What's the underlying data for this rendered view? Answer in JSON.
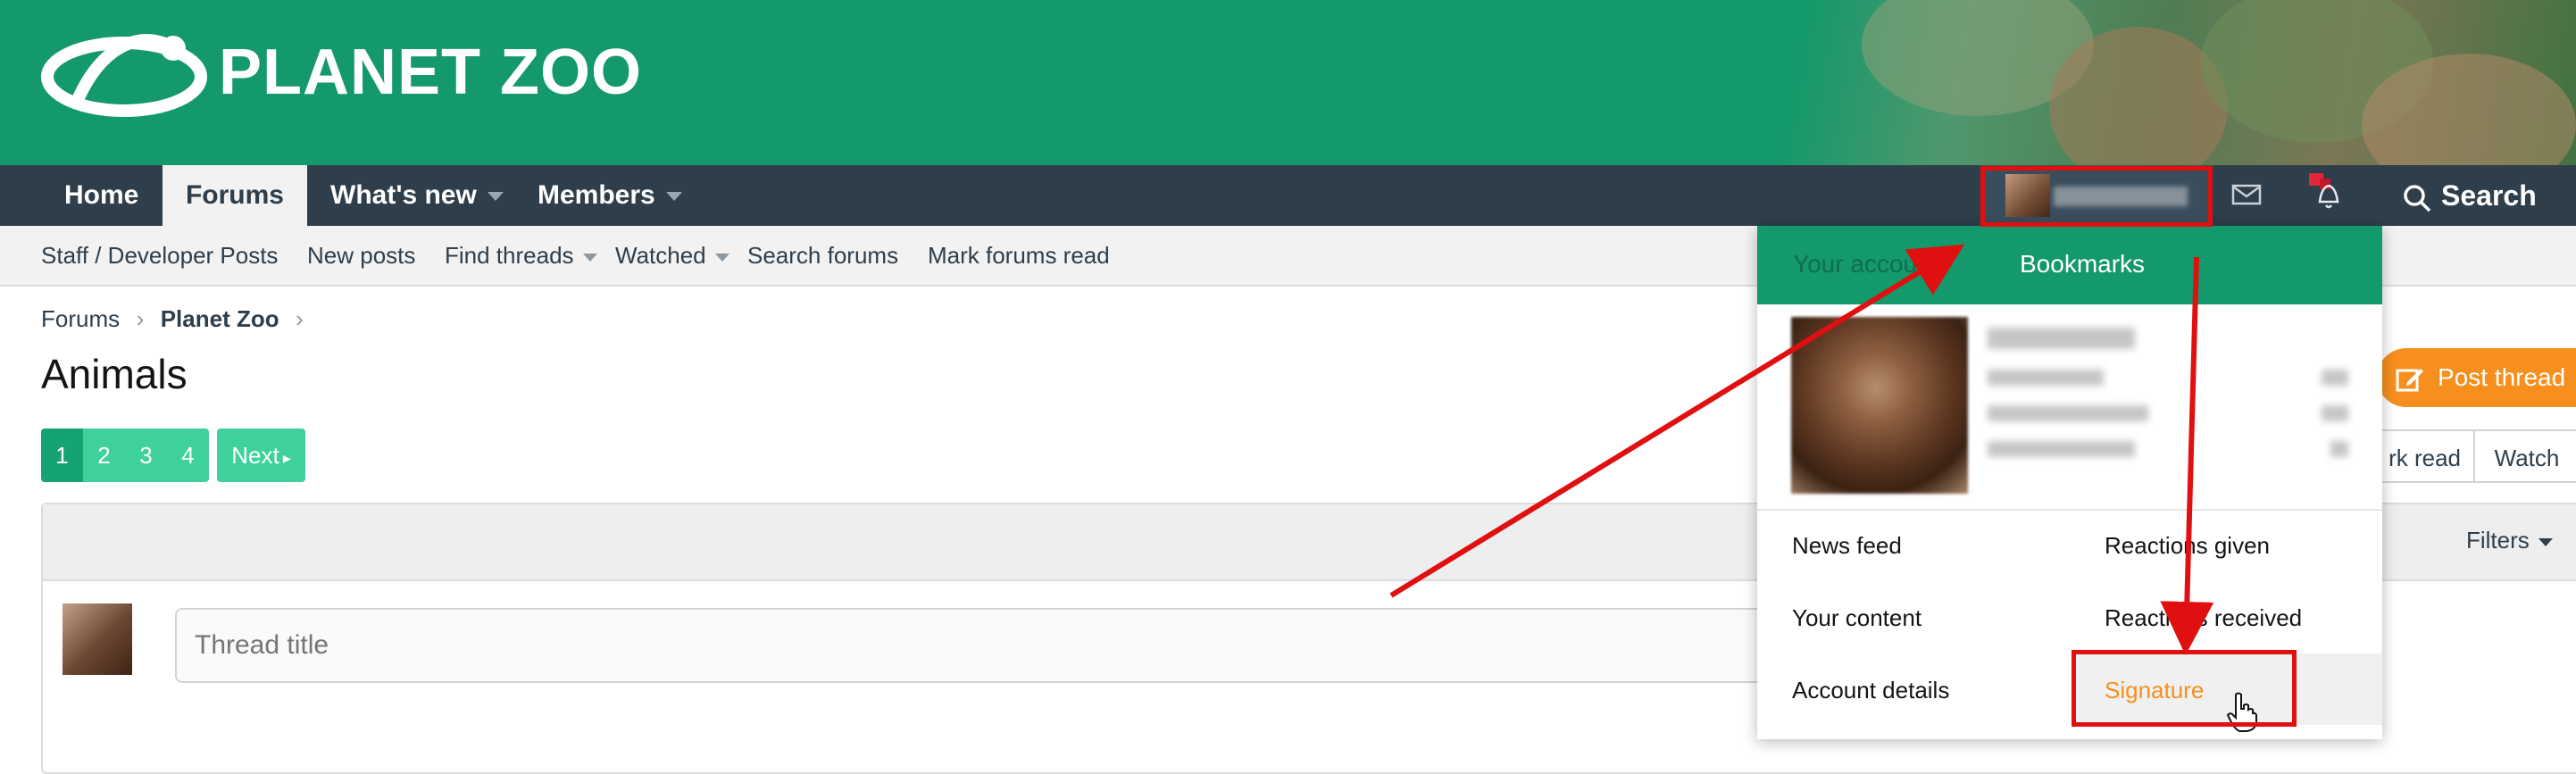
{
  "brand": {
    "logo_text": "PLANET ZOO",
    "header_color": "#13996b",
    "nav_color": "#2e3e4b",
    "accent": "#3ed19c",
    "orange": "#f78f1e"
  },
  "nav": {
    "tabs": [
      {
        "label": "Home"
      },
      {
        "label": "Forums",
        "active": true
      },
      {
        "label": "What's new",
        "has_menu": true
      },
      {
        "label": "Members",
        "has_menu": true
      }
    ],
    "search_label": "Search"
  },
  "subnav": {
    "links": [
      {
        "label": "Staff / Developer Posts"
      },
      {
        "label": "New posts"
      },
      {
        "label": "Find threads",
        "has_menu": true
      },
      {
        "label": "Watched",
        "has_menu": true
      },
      {
        "label": "Search forums"
      },
      {
        "label": "Mark forums read"
      }
    ]
  },
  "breadcrumb": {
    "items": [
      "Forums",
      "Planet Zoo"
    ]
  },
  "page": {
    "title": "Animals",
    "pagination": {
      "pages": [
        "1",
        "2",
        "3",
        "4"
      ],
      "current": "1",
      "next_label": "Next"
    },
    "filters_label": "Filters",
    "thread_title_placeholder": "Thread title",
    "post_thread_label": "Post thread",
    "mark_read_label": "rk read",
    "watch_label": "Watch"
  },
  "account_menu": {
    "tab_account": "Your account",
    "tab_bookmarks": "Bookmarks",
    "links": {
      "news_feed": "News feed",
      "reactions_given": "Reactions given",
      "your_content": "Your content",
      "reactions_received": "Reactions received",
      "account_details": "Account details",
      "signature": "Signature"
    }
  }
}
